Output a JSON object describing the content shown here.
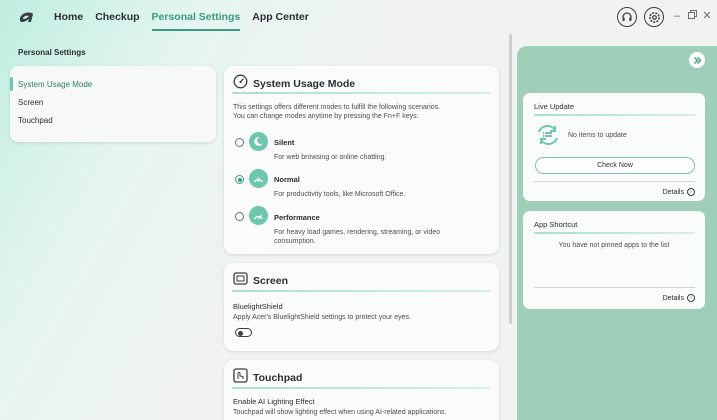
{
  "nav": {
    "items": [
      {
        "label": "Home"
      },
      {
        "label": "Checkup"
      },
      {
        "label": "Personal Settings"
      },
      {
        "label": "App Center"
      }
    ]
  },
  "left": {
    "title": "Personal Settings",
    "items": [
      {
        "label": "System Usage Mode"
      },
      {
        "label": "Screen"
      },
      {
        "label": "Touchpad"
      }
    ]
  },
  "system_usage": {
    "title": "System Usage Mode",
    "desc1": "This settings offers different modes to fulfill the following scenarios.",
    "desc2": "You can change modes anytime by pressing the Fn+F keys.",
    "modes": [
      {
        "name": "Silent",
        "desc": "For web browsing or online chatting.",
        "selected": false
      },
      {
        "name": "Normal",
        "desc": "For productivity tools, like Microsoft Office.",
        "selected": true
      },
      {
        "name": "Performance",
        "desc1": "For heavy load games, rendering, streaming, or video",
        "desc2": "consumption.",
        "selected": false
      }
    ]
  },
  "screen": {
    "title": "Screen",
    "setting": "BluelightShield",
    "desc": "Apply Acer's BluelightShield settings to protect your eyes.",
    "enabled": false
  },
  "touchpad": {
    "title": "Touchpad",
    "setting": "Enable AI Lighting Effect",
    "desc": "Touchpad will show lighting effect when using AI-related applications."
  },
  "live_update": {
    "title": "Live Update",
    "status": "No items to update",
    "button": "Check Now",
    "details": "Details"
  },
  "app_shortcut": {
    "title": "App Shortcut",
    "status": "You have not pinned apps to the list",
    "details": "Details"
  },
  "colors": {
    "accent": "#3a9a7f",
    "mint": "#6cc7ac",
    "panel": "#9fcfb8"
  }
}
